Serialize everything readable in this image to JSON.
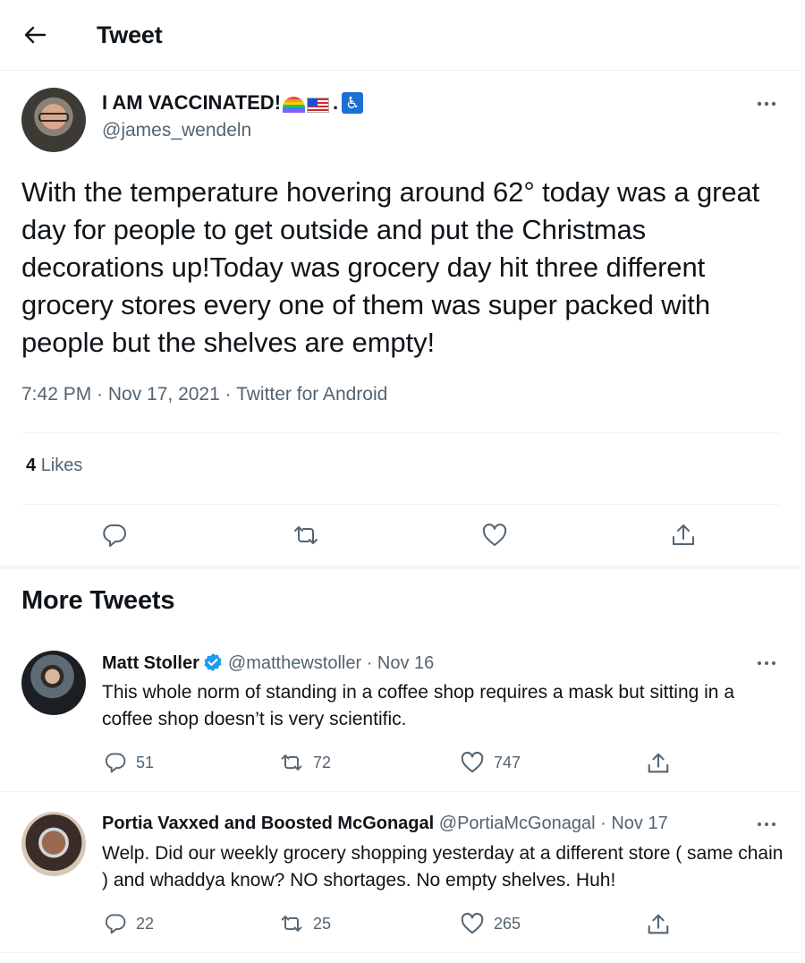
{
  "header": {
    "title": "Tweet",
    "back_icon": "arrow-left-icon"
  },
  "main_tweet": {
    "author_name": "I AM VACCINATED!",
    "author_emojis": [
      "rainbow-emoji",
      "us-flag-emoji",
      "wheelchair-emoji"
    ],
    "author_separator": ".",
    "handle": "@james_wendeln",
    "text": "With the temperature hovering around 62° today was a great day for people to get outside and put the Christmas decorations up!Today was grocery day hit three different grocery stores every one of them was super packed with people but the shelves are empty!",
    "timestamp": "7:42 PM · Nov 17, 2021 · Twitter for Android",
    "likes_count": "4",
    "likes_label": "Likes"
  },
  "section_title": "More Tweets",
  "more_tweets": [
    {
      "name": "Matt Stoller",
      "verified": true,
      "handle_date": "@matthewstoller · Nov 16",
      "text": "This whole norm of standing in a coffee shop requires a mask but sitting in a coffee shop doesn’t is very scientific.",
      "replies": "51",
      "retweets": "72",
      "likes": "747"
    },
    {
      "name": "Portia Vaxxed and Boosted McGonagal",
      "verified": false,
      "handle_date": "@PortiaMcGonagal · Nov 17",
      "text": "Welp. Did our weekly grocery shopping yesterday at a different store ( same chain ) and whaddya know? NO shortages. No empty shelves. Huh!",
      "replies": "22",
      "retweets": "25",
      "likes": "265"
    }
  ],
  "colors": {
    "text": "#0f1419",
    "secondary": "#536471",
    "border": "#eff3f4",
    "verified": "#1d9bf0"
  }
}
